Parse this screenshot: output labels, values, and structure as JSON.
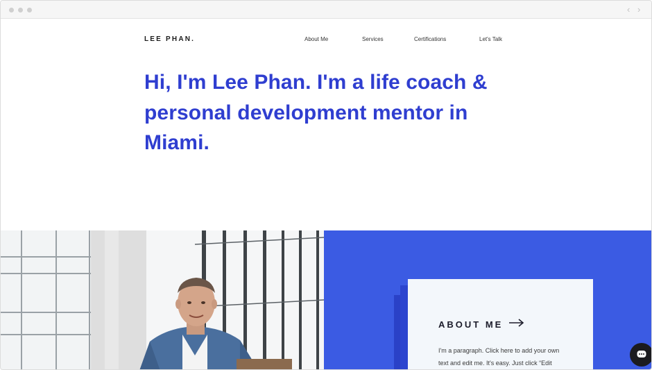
{
  "browser": {
    "back_glyph": "‹",
    "forward_glyph": "›"
  },
  "header": {
    "logo": "LEE PHAN.",
    "nav": [
      "About Me",
      "Services",
      "Certifications",
      "Let's Talk"
    ]
  },
  "hero": {
    "headline": "Hi, I'm Lee Phan. I'm a life coach & personal development mentor in Miami."
  },
  "about_card": {
    "title": "ABOUT ME",
    "paragraph": "I'm a paragraph. Click here to add your own text and edit me. It's easy. Just click “Edit"
  },
  "colors": {
    "accent_blue": "#2f3ed0",
    "panel_blue": "#3b5be3",
    "card_bg": "#f3f7fb",
    "chat_button": "#1b1b1f"
  },
  "icons": {
    "arrow": "right-arrow-icon",
    "chat": "chat-bubble-icon"
  }
}
